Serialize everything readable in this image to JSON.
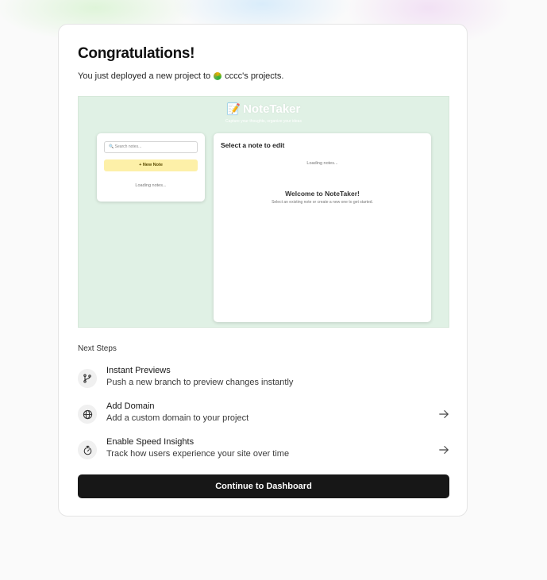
{
  "header": {
    "title": "Congratulations!",
    "subtitle_prefix": "You just deployed a new project to",
    "team_name": "cccc's projects."
  },
  "preview": {
    "app_icon": "memo-icon",
    "app_emoji": "📝",
    "app_name": "NoteTaker",
    "tagline": "Capture your thoughts, organize your ideas",
    "search_placeholder": "🔍 Search notes...",
    "new_note_label": "+ New Note",
    "sidebar_loading": "Loading notes...",
    "editor_title": "Select a note to edit",
    "editor_loading": "Loading notes...",
    "welcome_title": "Welcome to NoteTaker!",
    "welcome_subtitle": "Select an existing note or create a new one to get started."
  },
  "next_steps": {
    "heading": "Next Steps",
    "items": [
      {
        "icon": "git-branch-icon",
        "title": "Instant Previews",
        "description": "Push a new branch to preview changes instantly",
        "has_arrow": false
      },
      {
        "icon": "globe-icon",
        "title": "Add Domain",
        "description": "Add a custom domain to your project",
        "has_arrow": true
      },
      {
        "icon": "stopwatch-icon",
        "title": "Enable Speed Insights",
        "description": "Track how users experience your site over time",
        "has_arrow": true
      }
    ]
  },
  "cta": {
    "label": "Continue to Dashboard"
  },
  "colors": {
    "background": "#fafafa",
    "card": "#ffffff",
    "preview_bg": "#e0f1e5",
    "new_note_bg": "#fdf0a8",
    "button_bg": "#171717",
    "button_text": "#ffffff"
  }
}
